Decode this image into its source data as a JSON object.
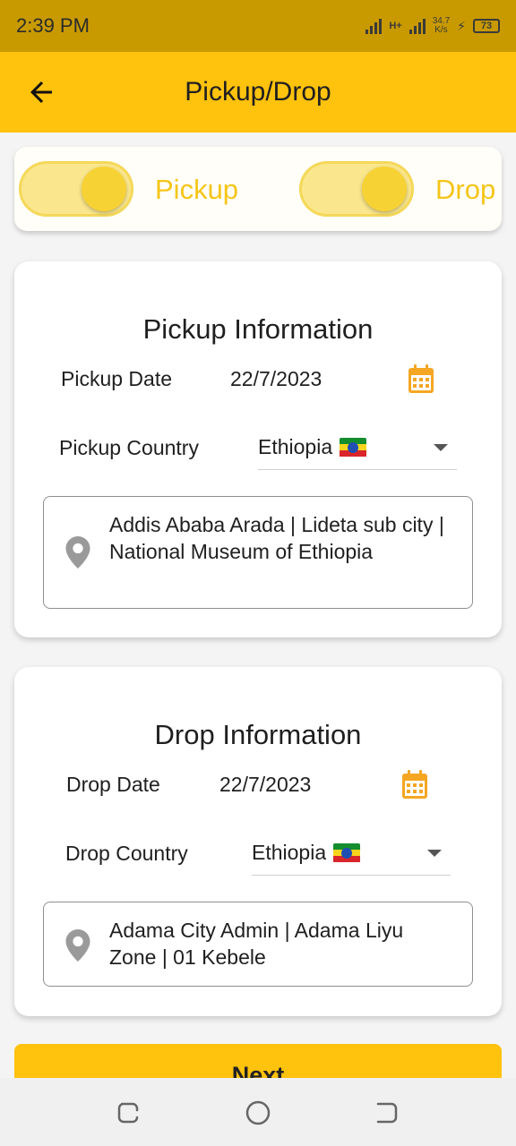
{
  "status_bar": {
    "time": "2:39 PM",
    "net_speed_value": "34.7",
    "net_speed_unit": "K/s",
    "network_type": "H+",
    "battery": "73"
  },
  "app_bar": {
    "title": "Pickup/Drop",
    "back_icon": "arrow-left-icon"
  },
  "toggles": {
    "pickup": {
      "label": "Pickup",
      "on": true
    },
    "drop": {
      "label": "Drop",
      "on": true
    }
  },
  "pickup": {
    "heading": "Pickup Information",
    "date_label": "Pickup Date",
    "date_value": "22/7/2023",
    "country_label": "Pickup Country",
    "country_value": "Ethiopia",
    "address": "Addis Ababa Arada | Lideta sub city | National Museum of Ethiopia"
  },
  "drop": {
    "heading": "Drop Information",
    "date_label": "Drop Date",
    "date_value": "22/7/2023",
    "country_label": "Drop Country",
    "country_value": "Ethiopia",
    "address": "Adama City Admin | Adama Liyu Zone | 01 Kebele"
  },
  "next_button": "Next",
  "colors": {
    "accent": "#ffc20d",
    "status_bar": "#c89a00",
    "calendar_icon": "#f5a623",
    "toggle_text": "#f5c518"
  },
  "nav_bar": {
    "icons": [
      "recents-icon",
      "home-icon",
      "back-icon"
    ]
  }
}
